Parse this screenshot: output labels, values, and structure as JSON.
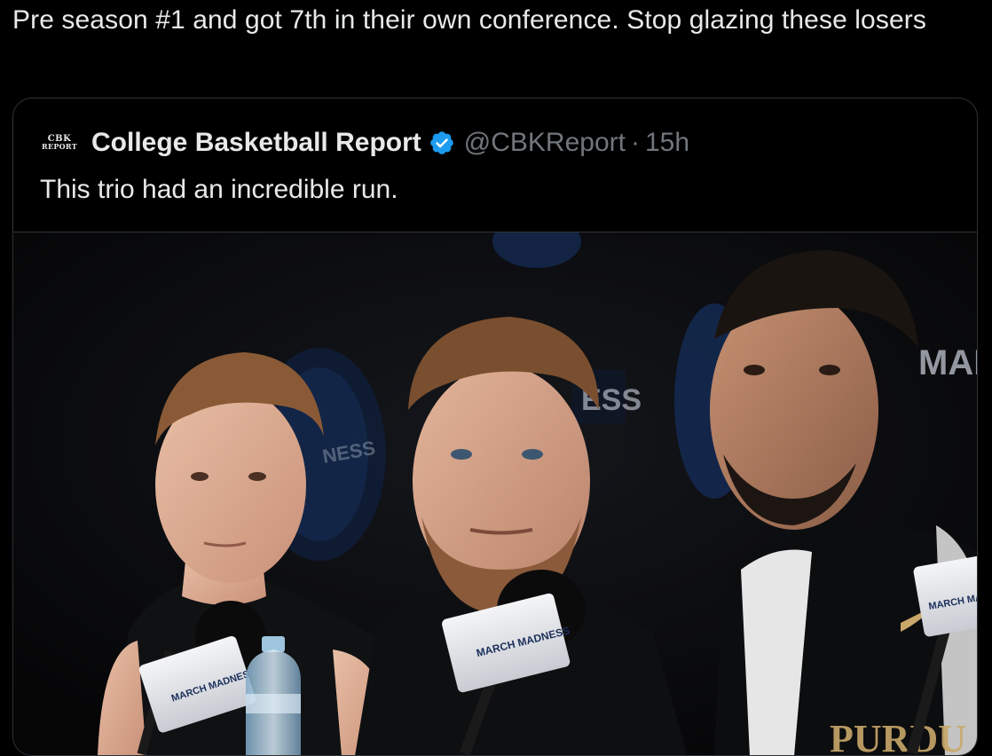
{
  "post": {
    "text": "Pre season #1 and got 7th in their own conference. Stop glazing these losers"
  },
  "quoted_tweet": {
    "avatar_line1": "CBK",
    "avatar_line2": "REPORT",
    "display_name": "College Basketball Report",
    "verified": true,
    "handle": "@CBKReport",
    "separator": "·",
    "timestamp": "15h",
    "text": "This trio had an incredible run.",
    "media": {
      "type": "photo",
      "banner_words": [
        "MARC",
        "ESS",
        "NESS"
      ],
      "mic_flags": [
        "MARCH MADNESS",
        "MARCH MADNESS",
        "MARCH MADNESS"
      ]
    }
  },
  "colors": {
    "background": "#000000",
    "primary_text": "#e7e9ea",
    "secondary_text": "#71767b",
    "border": "#2f3336",
    "verified_blue": "#1d9bf0"
  }
}
